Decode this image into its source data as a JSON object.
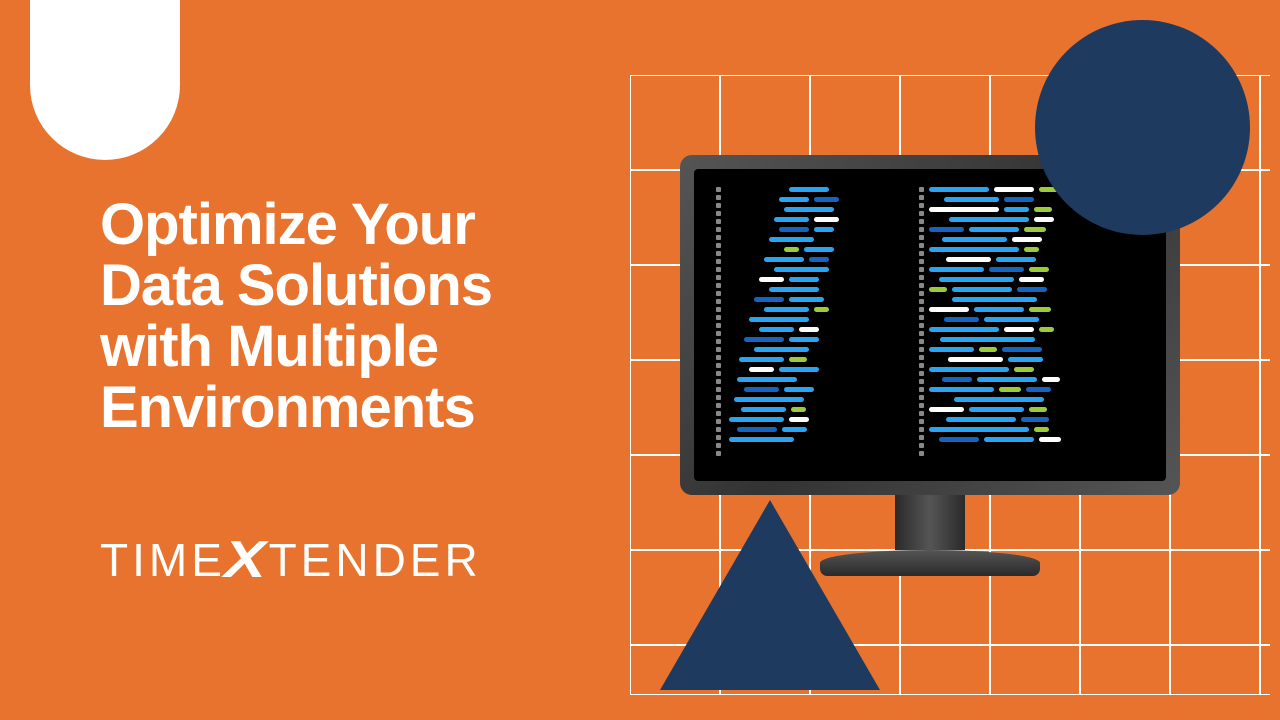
{
  "headline": "Optimize Your\nData Solutions\nwith Multiple\nEnvironments",
  "brand": {
    "part1": "TIME",
    "x": "X",
    "part2": "TENDER"
  },
  "colors": {
    "bg": "#e8732e",
    "navy": "#1e3a5f",
    "white": "#ffffff"
  },
  "code_illustration": {
    "left_lines": [
      [
        [
          "sp",
          60
        ],
        [
          "c-blue",
          40
        ]
      ],
      [
        [
          "sp",
          50
        ],
        [
          "c-blue",
          30
        ],
        [
          "c-dblue",
          25
        ]
      ],
      [
        [
          "sp",
          55
        ],
        [
          "c-blue",
          50
        ]
      ],
      [
        [
          "sp",
          45
        ],
        [
          "c-blue",
          35
        ],
        [
          "c-white",
          25
        ]
      ],
      [
        [
          "sp",
          50
        ],
        [
          "c-dblue",
          30
        ],
        [
          "c-blue",
          20
        ]
      ],
      [
        [
          "sp",
          40
        ],
        [
          "c-blue",
          45
        ]
      ],
      [
        [
          "sp",
          55
        ],
        [
          "c-green",
          15
        ],
        [
          "c-blue",
          30
        ]
      ],
      [
        [
          "sp",
          35
        ],
        [
          "c-blue",
          40
        ],
        [
          "c-dblue",
          20
        ]
      ],
      [
        [
          "sp",
          45
        ],
        [
          "c-blue",
          55
        ]
      ],
      [
        [
          "sp",
          30
        ],
        [
          "c-white",
          25
        ],
        [
          "c-blue",
          30
        ]
      ],
      [
        [
          "sp",
          40
        ],
        [
          "c-blue",
          50
        ]
      ],
      [
        [
          "sp",
          25
        ],
        [
          "c-dblue",
          30
        ],
        [
          "c-blue",
          35
        ]
      ],
      [
        [
          "sp",
          35
        ],
        [
          "c-blue",
          45
        ],
        [
          "c-green",
          15
        ]
      ],
      [
        [
          "sp",
          20
        ],
        [
          "c-blue",
          60
        ]
      ],
      [
        [
          "sp",
          30
        ],
        [
          "c-blue",
          35
        ],
        [
          "c-white",
          20
        ]
      ],
      [
        [
          "sp",
          15
        ],
        [
          "c-dblue",
          40
        ],
        [
          "c-blue",
          30
        ]
      ],
      [
        [
          "sp",
          25
        ],
        [
          "c-blue",
          55
        ]
      ],
      [
        [
          "sp",
          10
        ],
        [
          "c-blue",
          45
        ],
        [
          "c-green",
          18
        ]
      ],
      [
        [
          "sp",
          20
        ],
        [
          "c-white",
          25
        ],
        [
          "c-blue",
          40
        ]
      ],
      [
        [
          "sp",
          8
        ],
        [
          "c-blue",
          60
        ]
      ],
      [
        [
          "sp",
          15
        ],
        [
          "c-dblue",
          35
        ],
        [
          "c-blue",
          30
        ]
      ],
      [
        [
          "sp",
          5
        ],
        [
          "c-blue",
          70
        ]
      ],
      [
        [
          "sp",
          12
        ],
        [
          "c-blue",
          45
        ],
        [
          "c-green",
          15
        ]
      ],
      [
        [
          "sp",
          0
        ],
        [
          "c-blue",
          55
        ],
        [
          "c-white",
          20
        ]
      ],
      [
        [
          "sp",
          8
        ],
        [
          "c-dblue",
          40
        ],
        [
          "c-blue",
          25
        ]
      ],
      [
        [
          "sp",
          0
        ],
        [
          "c-blue",
          65
        ]
      ]
    ],
    "right_lines": [
      [
        [
          "c-blue",
          60
        ],
        [
          "c-white",
          40
        ],
        [
          "c-green",
          20
        ]
      ],
      [
        [
          "sp",
          10
        ],
        [
          "c-blue",
          55
        ],
        [
          "c-dblue",
          30
        ]
      ],
      [
        [
          "c-white",
          70
        ],
        [
          "c-blue",
          25
        ],
        [
          "c-green",
          18
        ]
      ],
      [
        [
          "sp",
          15
        ],
        [
          "c-blue",
          80
        ],
        [
          "c-white",
          20
        ]
      ],
      [
        [
          "c-dblue",
          35
        ],
        [
          "c-blue",
          50
        ],
        [
          "c-green",
          22
        ]
      ],
      [
        [
          "sp",
          8
        ],
        [
          "c-blue",
          65
        ],
        [
          "c-white",
          30
        ]
      ],
      [
        [
          "c-blue",
          90
        ],
        [
          "c-green",
          15
        ]
      ],
      [
        [
          "sp",
          12
        ],
        [
          "c-white",
          45
        ],
        [
          "c-blue",
          40
        ]
      ],
      [
        [
          "c-blue",
          55
        ],
        [
          "c-dblue",
          35
        ],
        [
          "c-green",
          20
        ]
      ],
      [
        [
          "sp",
          5
        ],
        [
          "c-blue",
          75
        ],
        [
          "c-white",
          25
        ]
      ],
      [
        [
          "c-green",
          18
        ],
        [
          "c-blue",
          60
        ],
        [
          "c-dblue",
          30
        ]
      ],
      [
        [
          "sp",
          18
        ],
        [
          "c-blue",
          85
        ]
      ],
      [
        [
          "c-white",
          40
        ],
        [
          "c-blue",
          50
        ],
        [
          "c-green",
          22
        ]
      ],
      [
        [
          "sp",
          10
        ],
        [
          "c-dblue",
          35
        ],
        [
          "c-blue",
          55
        ]
      ],
      [
        [
          "c-blue",
          70
        ],
        [
          "c-white",
          30
        ],
        [
          "c-green",
          15
        ]
      ],
      [
        [
          "sp",
          6
        ],
        [
          "c-blue",
          95
        ]
      ],
      [
        [
          "c-blue",
          45
        ],
        [
          "c-green",
          18
        ],
        [
          "c-dblue",
          40
        ]
      ],
      [
        [
          "sp",
          14
        ],
        [
          "c-white",
          55
        ],
        [
          "c-blue",
          35
        ]
      ],
      [
        [
          "c-blue",
          80
        ],
        [
          "c-green",
          20
        ]
      ],
      [
        [
          "sp",
          8
        ],
        [
          "c-dblue",
          30
        ],
        [
          "c-blue",
          60
        ],
        [
          "c-white",
          18
        ]
      ],
      [
        [
          "c-blue",
          65
        ],
        [
          "c-green",
          22
        ],
        [
          "c-dblue",
          25
        ]
      ],
      [
        [
          "sp",
          20
        ],
        [
          "c-blue",
          90
        ]
      ],
      [
        [
          "c-white",
          35
        ],
        [
          "c-blue",
          55
        ],
        [
          "c-green",
          18
        ]
      ],
      [
        [
          "sp",
          12
        ],
        [
          "c-blue",
          70
        ],
        [
          "c-dblue",
          28
        ]
      ],
      [
        [
          "c-blue",
          100
        ],
        [
          "c-green",
          15
        ]
      ],
      [
        [
          "sp",
          5
        ],
        [
          "c-dblue",
          40
        ],
        [
          "c-blue",
          50
        ],
        [
          "c-white",
          22
        ]
      ]
    ]
  }
}
